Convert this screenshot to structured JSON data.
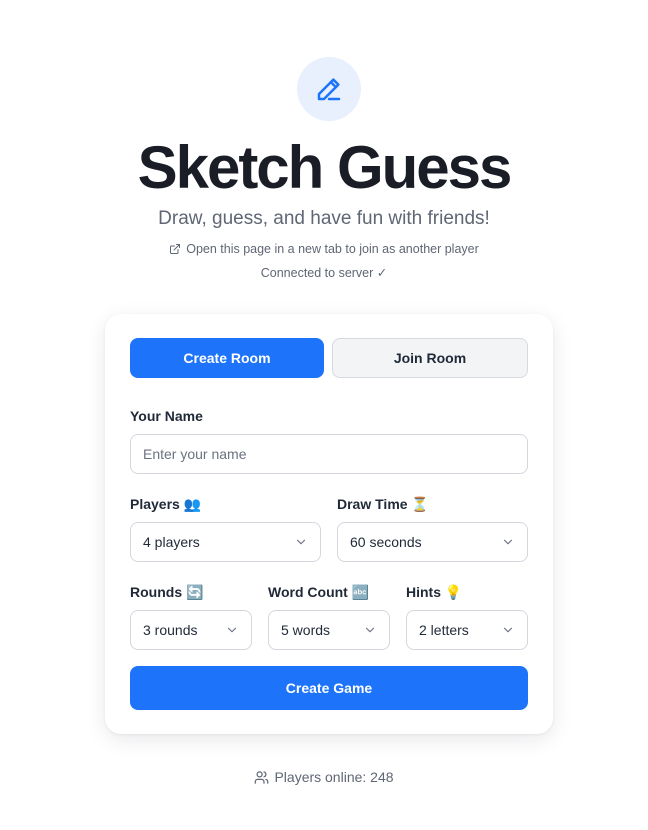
{
  "header": {
    "title": "Sketch Guess",
    "subtitle": "Draw, guess, and have fun with friends!",
    "new_tab_hint": "Open this page in a new tab to join as another player",
    "connection_status": "Connected to server ✓"
  },
  "tabs": {
    "create": "Create Room",
    "join": "Join Room"
  },
  "form": {
    "name": {
      "label": "Your Name",
      "placeholder": "Enter your name",
      "value": ""
    },
    "players": {
      "label": "Players 👥",
      "value": "4 players"
    },
    "draw_time": {
      "label": "Draw Time ⏳",
      "value": "60 seconds"
    },
    "rounds": {
      "label": "Rounds 🔄",
      "value": "3 rounds"
    },
    "word_count": {
      "label": "Word Count 🔤",
      "value": "5 words"
    },
    "hints": {
      "label": "Hints 💡",
      "value": "2 letters"
    },
    "submit_label": "Create Game"
  },
  "footer": {
    "players_online": "Players online: 248"
  },
  "icons": {
    "logo": "pencil-icon",
    "new_tab": "external-link-icon",
    "online": "users-icon",
    "dropdown": "chevron-down-icon"
  },
  "colors": {
    "accent": "#1d74fb",
    "logo_bg": "#e8f0fe",
    "title": "#1a1d26",
    "muted": "#5f6674"
  }
}
